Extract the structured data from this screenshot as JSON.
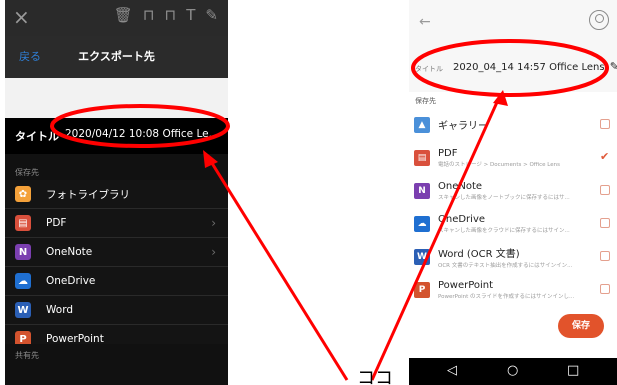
{
  "ios": {
    "close_glyph": "×",
    "tools": [
      "🗑",
      "⊓",
      "⊓",
      "T",
      "✎"
    ],
    "back_label": "戻る",
    "nav_title": "エクスポート先",
    "title_label": "タイトル",
    "title_value": "2020/04/12 10:08 Office Le...",
    "save_section": "保存先",
    "items": [
      {
        "label": "フォトライブラリ",
        "icon": "photos-icon",
        "color": "#f4a13a",
        "glyph": "✿",
        "chevron": false
      },
      {
        "label": "PDF",
        "icon": "pdf-icon",
        "color": "#d9503c",
        "glyph": "▤",
        "chevron": true
      },
      {
        "label": "OneNote",
        "icon": "onenote-icon",
        "color": "#7b3fb0",
        "glyph": "N",
        "chevron": true
      },
      {
        "label": "OneDrive",
        "icon": "onedrive-icon",
        "color": "#1f6fd1",
        "glyph": "☁",
        "chevron": false
      },
      {
        "label": "Word",
        "icon": "word-icon",
        "color": "#2b5fb5",
        "glyph": "W",
        "chevron": false
      },
      {
        "label": "PowerPoint",
        "icon": "powerpoint-icon",
        "color": "#d3532e",
        "glyph": "P",
        "chevron": false
      }
    ],
    "share_section": "共有先"
  },
  "android": {
    "back_glyph": "←",
    "title_label": "タイトル",
    "title_value": "2020_04_14 14:57 Office Lens",
    "edit_glyph": "✎",
    "save_section": "保存先",
    "items": [
      {
        "name": "ギャラリー",
        "sub": "",
        "icon": "gallery-icon",
        "color": "#4a90d9",
        "glyph": "▲",
        "checked": false
      },
      {
        "name": "PDF",
        "sub": "電話のストレージ > Documents > Office Lens",
        "icon": "pdf-icon",
        "color": "#d9503c",
        "glyph": "▤",
        "checked": true
      },
      {
        "name": "OneNote",
        "sub": "スキャンした画像をノートブックに保存するにはサ...",
        "icon": "onenote-icon",
        "color": "#7b3fb0",
        "glyph": "N",
        "checked": false
      },
      {
        "name": "OneDrive",
        "sub": "スキャンした画像をクラウドに保存するにはサイン...",
        "icon": "onedrive-icon",
        "color": "#1f6fd1",
        "glyph": "☁",
        "checked": false
      },
      {
        "name": "Word (OCR 文書)",
        "sub": "OCR 文書のテキスト抽出を作成するにはサインイン...",
        "icon": "word-icon",
        "color": "#2b5fb5",
        "glyph": "W",
        "checked": false
      },
      {
        "name": "PowerPoint",
        "sub": "PowerPoint のスライドを作成するにはサインインし...",
        "icon": "powerpoint-icon",
        "color": "#d3532e",
        "glyph": "P",
        "checked": false
      }
    ],
    "save_button": "保存",
    "nav": {
      "back": "◁",
      "home": "○",
      "recent": "□"
    }
  },
  "annotation": {
    "callout_text": "ココ",
    "color": "#ff0000"
  }
}
